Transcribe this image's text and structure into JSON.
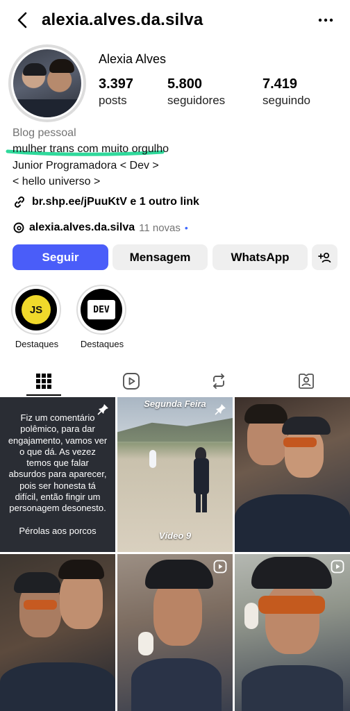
{
  "header": {
    "username": "alexia.alves.da.silva",
    "back_icon": "chevron-left-icon",
    "more_icon": "ellipsis-icon"
  },
  "profile": {
    "display_name": "Alexia Alves",
    "stats": [
      {
        "value": "3.397",
        "label": "posts"
      },
      {
        "value": "5.800",
        "label": "seguidores"
      },
      {
        "value": "7.419",
        "label": "seguindo"
      }
    ],
    "category": "Blog pessoal",
    "bio_lines": [
      "mulher trans com muito orgulho",
      "Junior Programadora < Dev >",
      "< hello universo >"
    ],
    "link_text": "br.shp.ee/jPuuKtV e 1 outro link",
    "threads_handle": "alexia.alves.da.silva",
    "threads_new": "11 novas",
    "highlight_color": "#2fd99b"
  },
  "actions": {
    "follow": "Seguir",
    "message": "Mensagem",
    "whatsapp": "WhatsApp",
    "add_user_icon": "add-user-icon",
    "accent": "#4a5df9"
  },
  "highlights": [
    {
      "label": "Destaques",
      "badge": "JS"
    },
    {
      "label": "Destaques",
      "badge": "DEV"
    }
  ],
  "tabs": [
    "grid-icon",
    "reels-icon",
    "repost-icon",
    "tagged-icon"
  ],
  "posts": {
    "text_post": "Fiz um comentário polêmico, para dar engajamento, vamos ver o que dá. As vezez temos que falar absurdos para aparecer, pois ser honesta tá difícil, então fingir um personagem desonesto.\n\nPérolas aos porcos",
    "video_top_caption": "Segunda Feira",
    "video_bottom_caption": "Vídeo 9"
  }
}
